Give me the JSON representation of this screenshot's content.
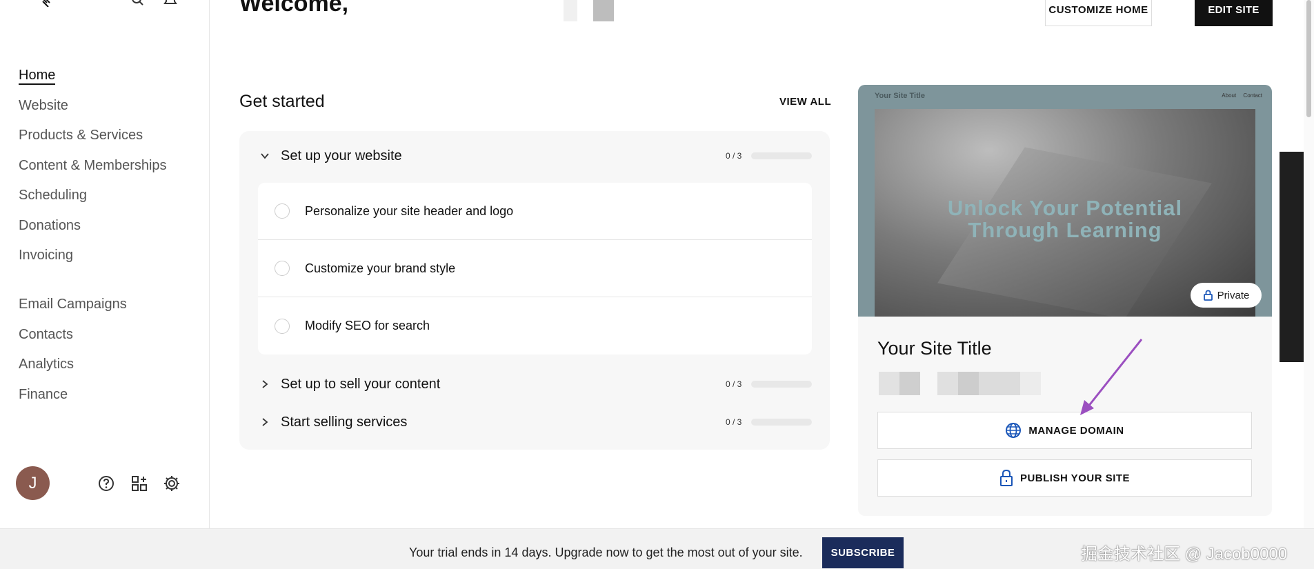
{
  "sidebar": {
    "nav_primary": [
      "Home",
      "Website",
      "Products & Services",
      "Content & Memberships",
      "Scheduling",
      "Donations",
      "Invoicing"
    ],
    "nav_secondary": [
      "Email Campaigns",
      "Contacts",
      "Analytics",
      "Finance"
    ],
    "active_item": "Home",
    "avatar_initial": "J",
    "icons": [
      "logo-icon",
      "search-icon",
      "bell-icon",
      "help-icon",
      "apps-icon",
      "settings-icon"
    ]
  },
  "header": {
    "welcome": "Welcome,",
    "customize_home": "CUSTOMIZE HOME",
    "edit_site": "EDIT SITE"
  },
  "get_started": {
    "title": "Get started",
    "view_all": "VIEW ALL",
    "sections": [
      {
        "label": "Set up your website",
        "progress": "0 / 3",
        "completed": 0,
        "total": 3,
        "expanded": true
      },
      {
        "label": "Set up to sell your content",
        "progress": "0 / 3",
        "completed": 0,
        "total": 3,
        "expanded": false
      },
      {
        "label": "Start selling services",
        "progress": "0 / 3",
        "completed": 0,
        "total": 3,
        "expanded": false
      }
    ],
    "tasks": [
      "Personalize your site header and logo",
      "Customize your brand style",
      "Modify SEO for search"
    ]
  },
  "site_card": {
    "preview_title": "Your Site Title",
    "preview_nav": [
      "About",
      "Contact"
    ],
    "preview_headline_1": "Unlock Your Potential",
    "preview_headline_2": "Through Learning",
    "private_label": "Private",
    "site_title": "Your Site Title",
    "manage_domain": "MANAGE DOMAIN",
    "publish": "PUBLISH YOUR SITE",
    "accent_color": "#1a56b8"
  },
  "banner": {
    "message": "Your trial ends in 14 days. Upgrade now to get the most out of your site.",
    "subscribe": "SUBSCRIBE",
    "button_color": "#1b2c5b"
  },
  "watermark": "掘金技术社区 @ Jacob0000"
}
